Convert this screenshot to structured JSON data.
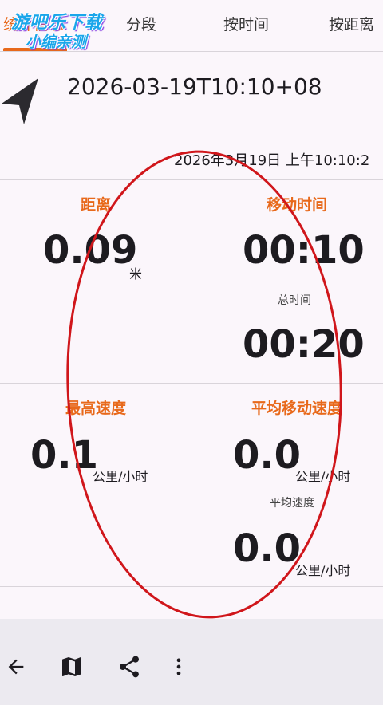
{
  "tabs": [
    {
      "label": "统计信息"
    },
    {
      "label": "分段"
    },
    {
      "label": "按时间"
    },
    {
      "label": "按距离"
    }
  ],
  "watermark": {
    "line1": "游吧乐下载",
    "line2": "小编亲测"
  },
  "track": {
    "title": "2026-03-19T10:10+08",
    "start_time": "2026年3月19日 上午10:10:2"
  },
  "stats": {
    "distance": {
      "label": "距离",
      "value": "0.09",
      "unit": "米"
    },
    "moving_time": {
      "label": "移动时间",
      "value": "00:10"
    },
    "total_time": {
      "label": "总时间",
      "value": "00:20"
    },
    "max_speed": {
      "label": "最高速度",
      "value": "0.1",
      "unit": "公里/小时"
    },
    "avg_moving_speed": {
      "label": "平均移动速度",
      "value": "0.0",
      "unit": "公里/小时"
    },
    "avg_speed": {
      "label": "平均速度",
      "value": "0.0",
      "unit": "公里/小时"
    }
  },
  "colors": {
    "accent": "#e8691b",
    "annotation": "#d0161b"
  },
  "bottom_bar": {
    "icons": [
      "back-arrow-icon",
      "map-icon",
      "share-icon",
      "more-vert-icon"
    ]
  }
}
